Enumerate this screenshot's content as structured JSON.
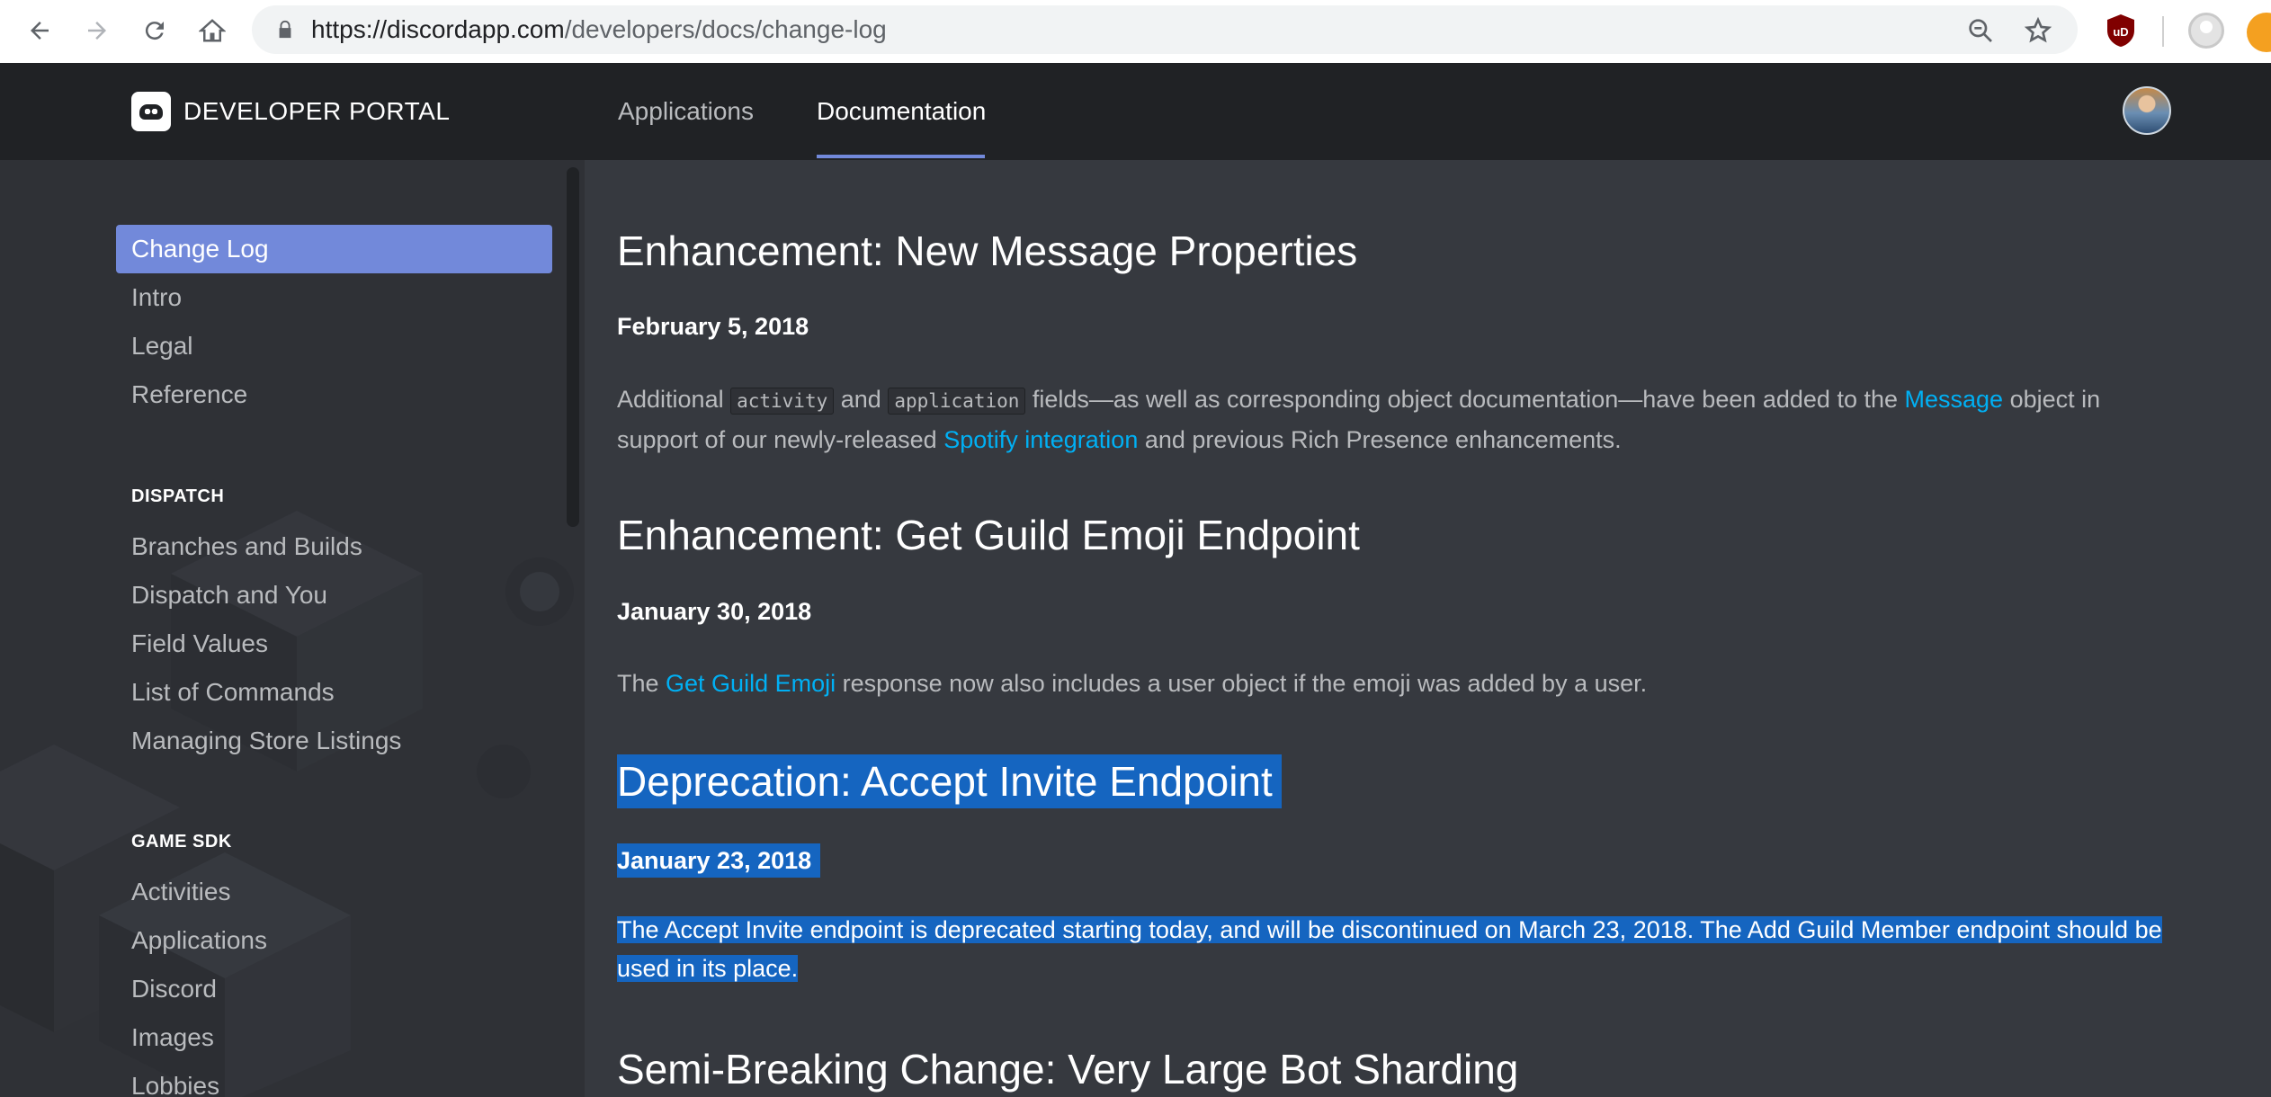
{
  "browser": {
    "url_host": "https://discordapp.com",
    "url_path": "/developers/docs/change-log"
  },
  "header": {
    "brand": "DEVELOPER PORTAL",
    "nav": [
      {
        "label": "Applications",
        "active": false
      },
      {
        "label": "Documentation",
        "active": true
      }
    ]
  },
  "sidebar": {
    "items": [
      {
        "label": "Change Log",
        "active": true
      },
      {
        "label": "Intro"
      },
      {
        "label": "Legal"
      },
      {
        "label": "Reference"
      }
    ],
    "sections": [
      {
        "heading": "DISPATCH",
        "items": [
          "Branches and Builds",
          "Dispatch and You",
          "Field Values",
          "List of Commands",
          "Managing Store Listings"
        ]
      },
      {
        "heading": "GAME SDK",
        "items": [
          "Activities",
          "Applications",
          "Discord",
          "Images",
          "Lobbies"
        ]
      }
    ]
  },
  "main": {
    "entries": [
      {
        "title": "Enhancement: New Message Properties",
        "date": "February 5, 2018",
        "p1": "Additional ",
        "code1": "activity",
        "p2": " and ",
        "code2": "application",
        "p3": " fields—as well as corresponding object documentation—have been added to the ",
        "link1": "Message",
        "p4": " object in support of our newly-released ",
        "link2": "Spotify integration",
        "p5": " and previous Rich Presence enhancements."
      },
      {
        "title": "Enhancement: Get Guild Emoji Endpoint",
        "date": "January 30, 2018",
        "p1": "The ",
        "link1": "Get Guild Emoji",
        "p2": " response now also includes a user object if the emoji was added by a user."
      },
      {
        "title": "Deprecation: Accept Invite Endpoint",
        "date": "January 23, 2018",
        "text": "The Accept Invite endpoint is deprecated starting today, and will be discontinued on March 23, 2018. The Add Guild Member endpoint should be used in its place.",
        "selected": true
      },
      {
        "title": "Semi-Breaking Change: Very Large Bot Sharding"
      }
    ]
  },
  "colors": {
    "accent": "#7289da",
    "link": "#00b0f4",
    "selection": "#1565c0"
  }
}
